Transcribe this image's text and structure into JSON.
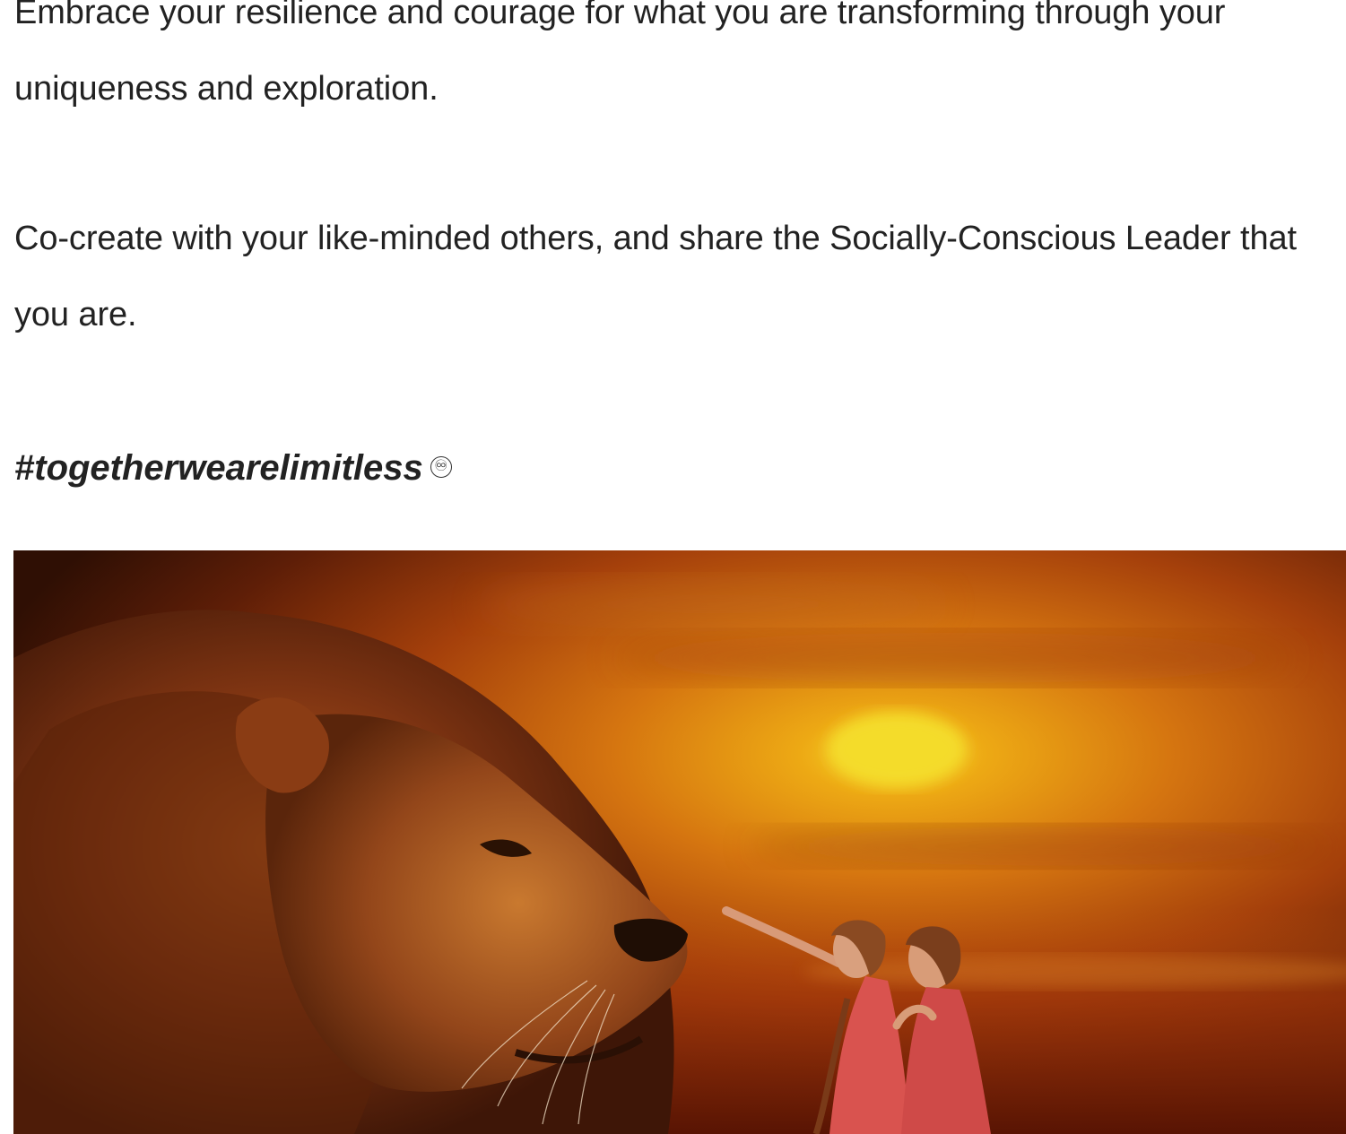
{
  "article": {
    "paragraph_1": "Embrace your resilience and courage for what you are transforming through your uniqueness and exploration.",
    "paragraph_2": "Co-create with your like-minded others, and share the Socially-Conscious Leader that you are.",
    "hashtag": "#togetherwearelimitless",
    "hashtag_emoji": "♾"
  },
  "hero_image": {
    "icon": "lion-and-two-girls-sunset-illustration",
    "colors": {
      "sky_top": "#3a1406",
      "sky_mid": "#c1570e",
      "sun": "#f2d02a",
      "ground": "#8a2a05",
      "lion_mane": "#7a3510",
      "dress": "#d9534f"
    }
  }
}
